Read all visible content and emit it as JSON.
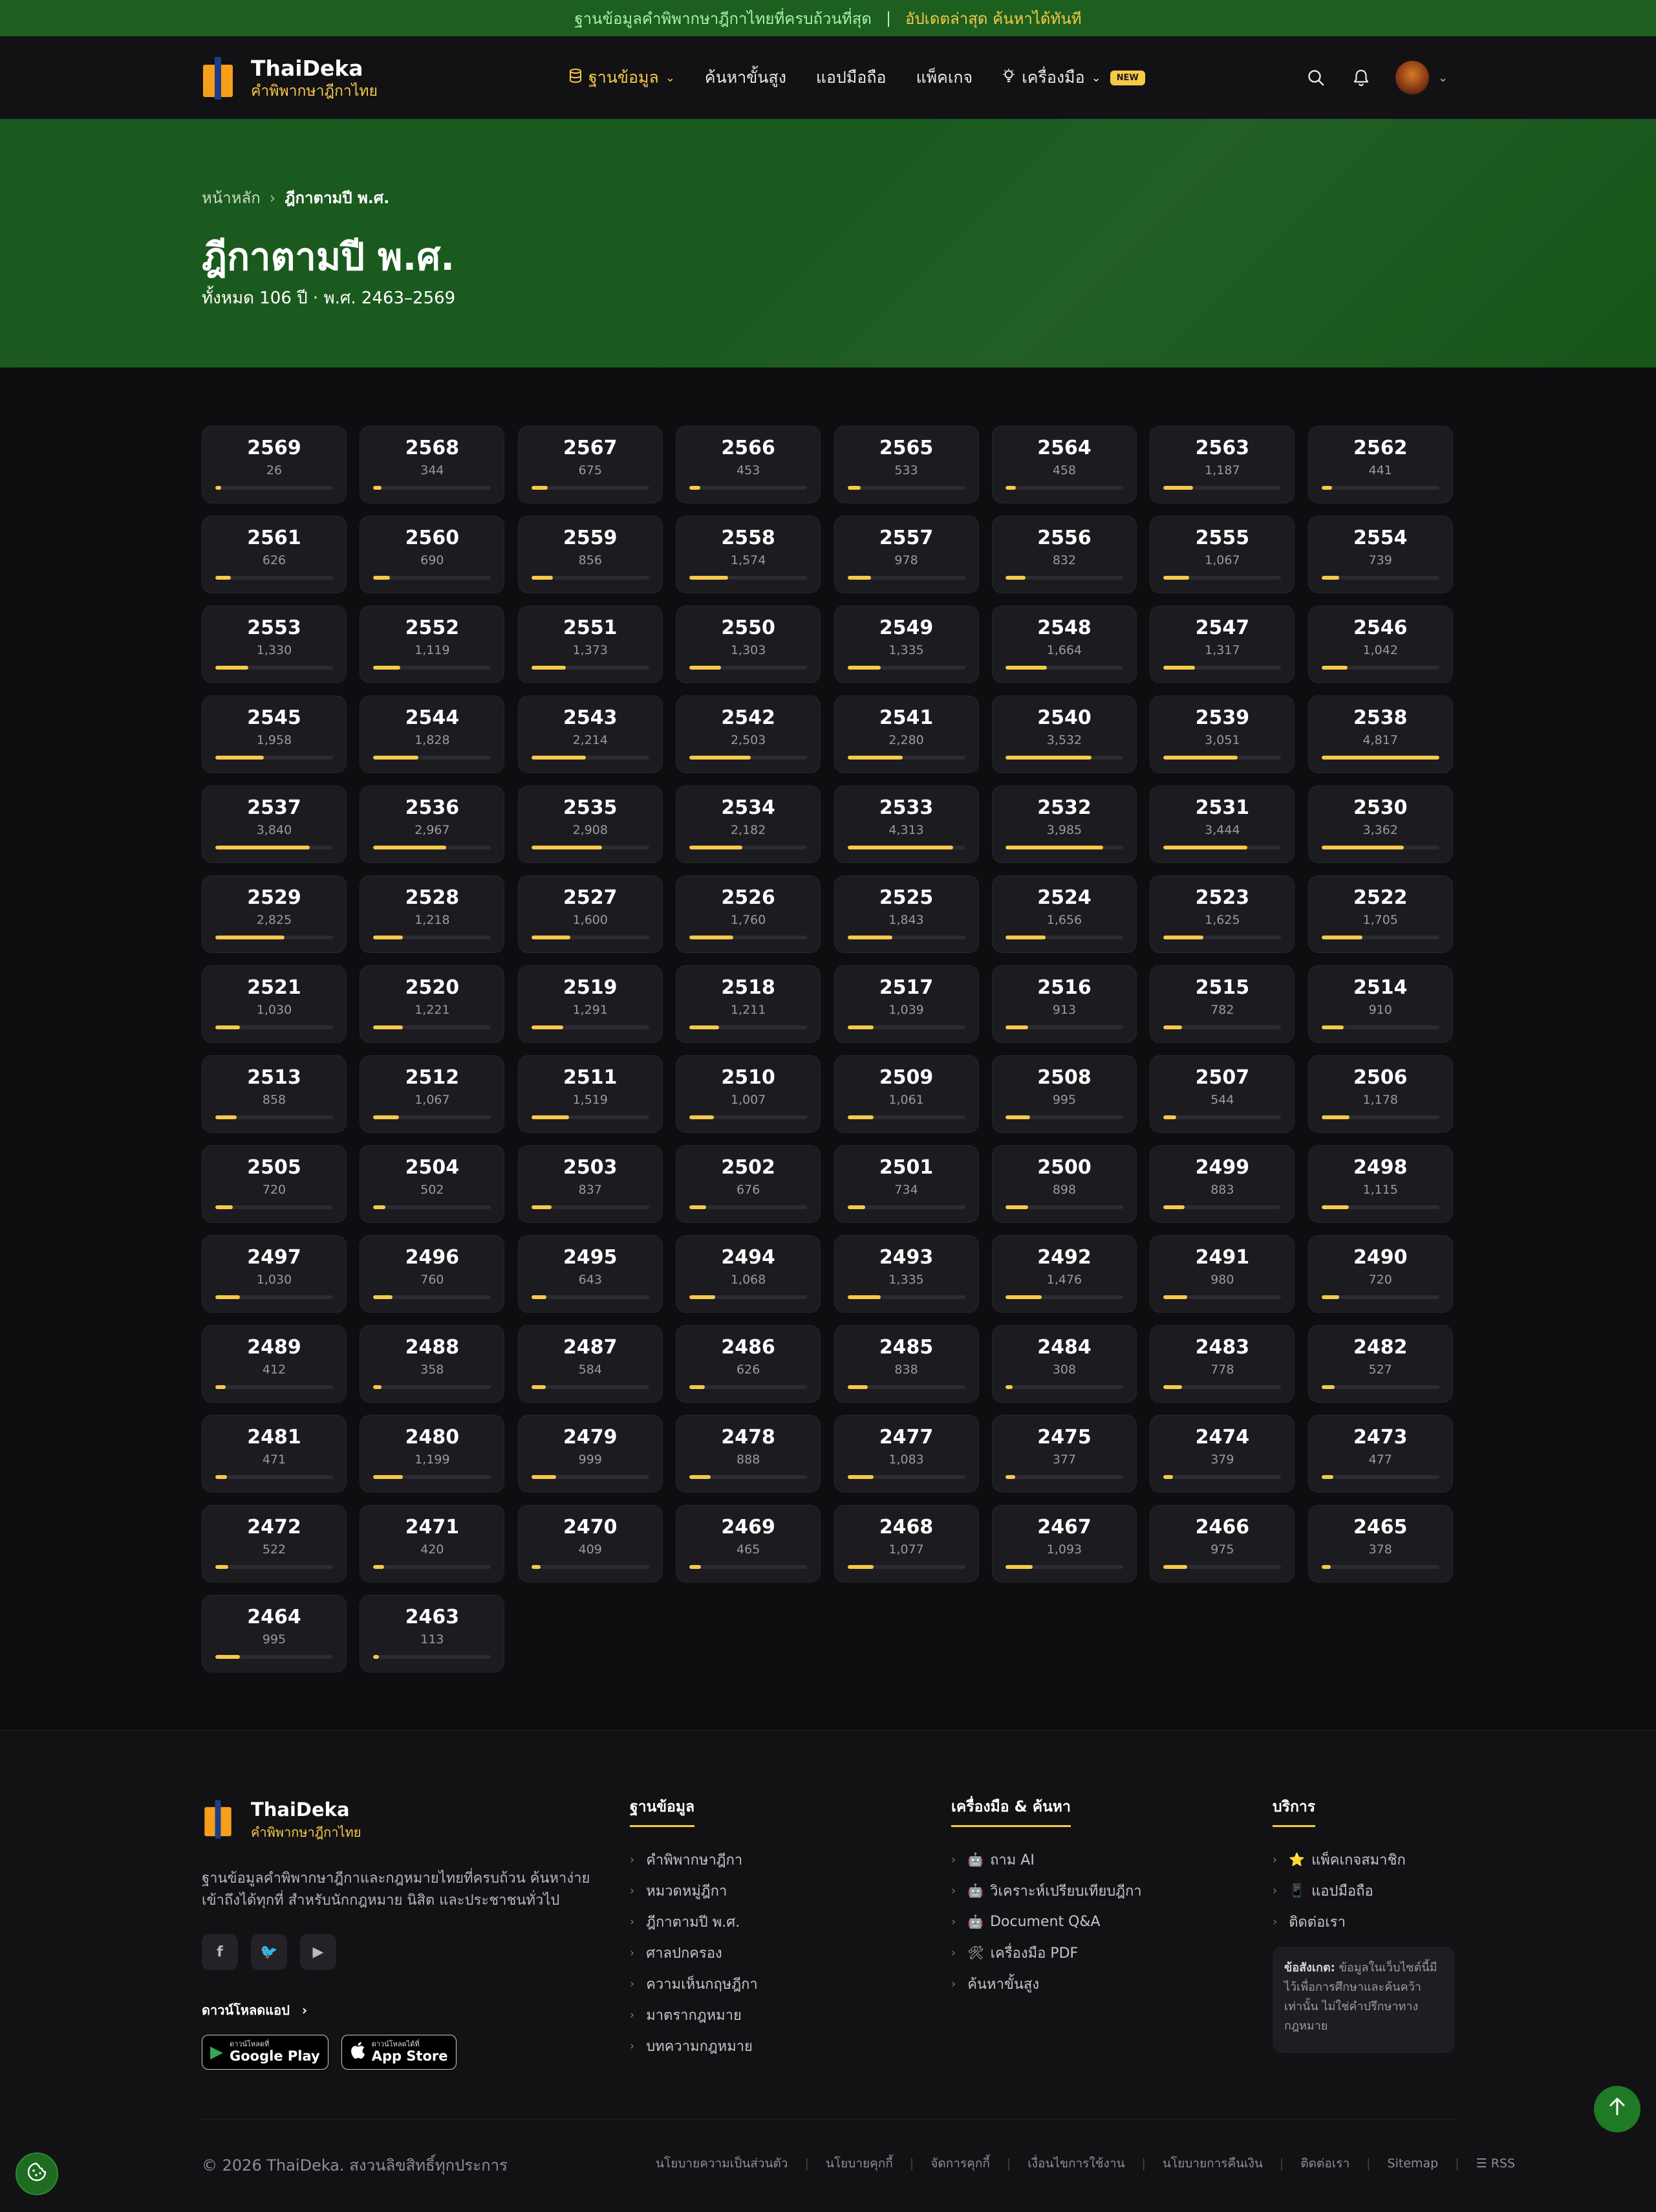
{
  "announcement": {
    "text": "ฐานข้อมูลคำพิพากษาฎีกาไทยที่ครบถ้วนที่สุด",
    "separator": "|",
    "highlight": "อัปเดตล่าสุด ค้นหาได้ทันที"
  },
  "brand": {
    "name": "ThaiDeka",
    "tagline": "คำพิพากษาฎีกาไทย"
  },
  "nav": {
    "items": [
      {
        "label": "ฐานข้อมูล",
        "icon": "database-icon",
        "has_dropdown": true,
        "active": true
      },
      {
        "label": "ค้นหาขั้นสูง"
      },
      {
        "label": "แอปมือถือ"
      },
      {
        "label": "แพ็คเกจ"
      },
      {
        "label": "เครื่องมือ",
        "icon": "lightbulb-icon",
        "has_dropdown": true,
        "badge": "NEW"
      }
    ]
  },
  "header_actions": {
    "search_icon": "search-icon",
    "bell_icon": "bell-icon",
    "avatar": "user-avatar"
  },
  "breadcrumb": {
    "home": "หน้าหลัก",
    "current": "ฎีกาตามปี พ.ศ."
  },
  "page": {
    "title": "ฎีกาตามปี พ.ศ.",
    "subtitle": "ทั้งหมด 106 ปี · พ.ศ. 2463–2569"
  },
  "years": [
    {
      "year": "2569",
      "count": "26",
      "level": 0.05
    },
    {
      "year": "2568",
      "count": "344",
      "level": 0.07
    },
    {
      "year": "2567",
      "count": "675",
      "level": 0.14
    },
    {
      "year": "2566",
      "count": "453",
      "level": 0.09
    },
    {
      "year": "2565",
      "count": "533",
      "level": 0.11
    },
    {
      "year": "2564",
      "count": "458",
      "level": 0.09
    },
    {
      "year": "2563",
      "count": "1,187",
      "level": 0.25
    },
    {
      "year": "2562",
      "count": "441",
      "level": 0.09
    },
    {
      "year": "2561",
      "count": "626",
      "level": 0.13
    },
    {
      "year": "2560",
      "count": "690",
      "level": 0.14
    },
    {
      "year": "2559",
      "count": "856",
      "level": 0.18
    },
    {
      "year": "2558",
      "count": "1,574",
      "level": 0.33
    },
    {
      "year": "2557",
      "count": "978",
      "level": 0.2
    },
    {
      "year": "2556",
      "count": "832",
      "level": 0.17
    },
    {
      "year": "2555",
      "count": "1,067",
      "level": 0.22
    },
    {
      "year": "2554",
      "count": "739",
      "level": 0.15
    },
    {
      "year": "2553",
      "count": "1,330",
      "level": 0.28
    },
    {
      "year": "2552",
      "count": "1,119",
      "level": 0.23
    },
    {
      "year": "2551",
      "count": "1,373",
      "level": 0.29
    },
    {
      "year": "2550",
      "count": "1,303",
      "level": 0.27
    },
    {
      "year": "2549",
      "count": "1,335",
      "level": 0.28
    },
    {
      "year": "2548",
      "count": "1,664",
      "level": 0.35
    },
    {
      "year": "2547",
      "count": "1,317",
      "level": 0.27
    },
    {
      "year": "2546",
      "count": "1,042",
      "level": 0.22
    },
    {
      "year": "2545",
      "count": "1,958",
      "level": 0.41
    },
    {
      "year": "2544",
      "count": "1,828",
      "level": 0.38
    },
    {
      "year": "2543",
      "count": "2,214",
      "level": 0.46
    },
    {
      "year": "2542",
      "count": "2,503",
      "level": 0.52
    },
    {
      "year": "2541",
      "count": "2,280",
      "level": 0.47
    },
    {
      "year": "2540",
      "count": "3,532",
      "level": 0.73
    },
    {
      "year": "2539",
      "count": "3,051",
      "level": 0.63
    },
    {
      "year": "2538",
      "count": "4,817",
      "level": 1.0
    },
    {
      "year": "2537",
      "count": "3,840",
      "level": 0.8
    },
    {
      "year": "2536",
      "count": "2,967",
      "level": 0.62
    },
    {
      "year": "2535",
      "count": "2,908",
      "level": 0.6
    },
    {
      "year": "2534",
      "count": "2,182",
      "level": 0.45
    },
    {
      "year": "2533",
      "count": "4,313",
      "level": 0.9
    },
    {
      "year": "2532",
      "count": "3,985",
      "level": 0.83
    },
    {
      "year": "2531",
      "count": "3,444",
      "level": 0.71
    },
    {
      "year": "2530",
      "count": "3,362",
      "level": 0.7
    },
    {
      "year": "2529",
      "count": "2,825",
      "level": 0.59
    },
    {
      "year": "2528",
      "count": "1,218",
      "level": 0.25
    },
    {
      "year": "2527",
      "count": "1,600",
      "level": 0.33
    },
    {
      "year": "2526",
      "count": "1,760",
      "level": 0.37
    },
    {
      "year": "2525",
      "count": "1,843",
      "level": 0.38
    },
    {
      "year": "2524",
      "count": "1,656",
      "level": 0.34
    },
    {
      "year": "2523",
      "count": "1,625",
      "level": 0.34
    },
    {
      "year": "2522",
      "count": "1,705",
      "level": 0.35
    },
    {
      "year": "2521",
      "count": "1,030",
      "level": 0.21
    },
    {
      "year": "2520",
      "count": "1,221",
      "level": 0.25
    },
    {
      "year": "2519",
      "count": "1,291",
      "level": 0.27
    },
    {
      "year": "2518",
      "count": "1,211",
      "level": 0.25
    },
    {
      "year": "2517",
      "count": "1,039",
      "level": 0.22
    },
    {
      "year": "2516",
      "count": "913",
      "level": 0.19
    },
    {
      "year": "2515",
      "count": "782",
      "level": 0.16
    },
    {
      "year": "2514",
      "count": "910",
      "level": 0.19
    },
    {
      "year": "2513",
      "count": "858",
      "level": 0.18
    },
    {
      "year": "2512",
      "count": "1,067",
      "level": 0.22
    },
    {
      "year": "2511",
      "count": "1,519",
      "level": 0.32
    },
    {
      "year": "2510",
      "count": "1,007",
      "level": 0.21
    },
    {
      "year": "2509",
      "count": "1,061",
      "level": 0.22
    },
    {
      "year": "2508",
      "count": "995",
      "level": 0.21
    },
    {
      "year": "2507",
      "count": "544",
      "level": 0.11
    },
    {
      "year": "2506",
      "count": "1,178",
      "level": 0.24
    },
    {
      "year": "2505",
      "count": "720",
      "level": 0.15
    },
    {
      "year": "2504",
      "count": "502",
      "level": 0.1
    },
    {
      "year": "2503",
      "count": "837",
      "level": 0.17
    },
    {
      "year": "2502",
      "count": "676",
      "level": 0.14
    },
    {
      "year": "2501",
      "count": "734",
      "level": 0.15
    },
    {
      "year": "2500",
      "count": "898",
      "level": 0.19
    },
    {
      "year": "2499",
      "count": "883",
      "level": 0.18
    },
    {
      "year": "2498",
      "count": "1,115",
      "level": 0.23
    },
    {
      "year": "2497",
      "count": "1,030",
      "level": 0.21
    },
    {
      "year": "2496",
      "count": "760",
      "level": 0.16
    },
    {
      "year": "2495",
      "count": "643",
      "level": 0.13
    },
    {
      "year": "2494",
      "count": "1,068",
      "level": 0.22
    },
    {
      "year": "2493",
      "count": "1,335",
      "level": 0.28
    },
    {
      "year": "2492",
      "count": "1,476",
      "level": 0.31
    },
    {
      "year": "2491",
      "count": "980",
      "level": 0.2
    },
    {
      "year": "2490",
      "count": "720",
      "level": 0.15
    },
    {
      "year": "2489",
      "count": "412",
      "level": 0.09
    },
    {
      "year": "2488",
      "count": "358",
      "level": 0.07
    },
    {
      "year": "2487",
      "count": "584",
      "level": 0.12
    },
    {
      "year": "2486",
      "count": "626",
      "level": 0.13
    },
    {
      "year": "2485",
      "count": "838",
      "level": 0.17
    },
    {
      "year": "2484",
      "count": "308",
      "level": 0.06
    },
    {
      "year": "2483",
      "count": "778",
      "level": 0.16
    },
    {
      "year": "2482",
      "count": "527",
      "level": 0.11
    },
    {
      "year": "2481",
      "count": "471",
      "level": 0.1
    },
    {
      "year": "2480",
      "count": "1,199",
      "level": 0.25
    },
    {
      "year": "2479",
      "count": "999",
      "level": 0.21
    },
    {
      "year": "2478",
      "count": "888",
      "level": 0.18
    },
    {
      "year": "2477",
      "count": "1,083",
      "level": 0.22
    },
    {
      "year": "2475",
      "count": "377",
      "level": 0.08
    },
    {
      "year": "2474",
      "count": "379",
      "level": 0.08
    },
    {
      "year": "2473",
      "count": "477",
      "level": 0.1
    },
    {
      "year": "2472",
      "count": "522",
      "level": 0.11
    },
    {
      "year": "2471",
      "count": "420",
      "level": 0.09
    },
    {
      "year": "2470",
      "count": "409",
      "level": 0.08
    },
    {
      "year": "2469",
      "count": "465",
      "level": 0.1
    },
    {
      "year": "2468",
      "count": "1,077",
      "level": 0.22
    },
    {
      "year": "2467",
      "count": "1,093",
      "level": 0.23
    },
    {
      "year": "2466",
      "count": "975",
      "level": 0.2
    },
    {
      "year": "2465",
      "count": "378",
      "level": 0.08
    },
    {
      "year": "2464",
      "count": "995",
      "level": 0.21
    },
    {
      "year": "2463",
      "count": "113",
      "level": 0.05
    }
  ],
  "footer": {
    "brand_name": "ThaiDeka",
    "brand_tagline": "คำพิพากษาฎีกาไทย",
    "description": "ฐานข้อมูลคำพิพากษาฎีกาและกฎหมายไทยที่ครบถ้วน ค้นหาง่าย เข้าถึงได้ทุกที่ สำหรับนักกฎหมาย นิสิต และประชาชนทั่วไป",
    "socials": [
      {
        "icon": "facebook-icon",
        "glyph": "f"
      },
      {
        "icon": "twitter-icon",
        "glyph": "🐦"
      },
      {
        "icon": "youtube-icon",
        "glyph": "▶"
      }
    ],
    "download_label": "ดาวน์โหลดแอป",
    "stores": [
      {
        "icon": "google-play-icon",
        "glyph": "▶",
        "small": "ดาวน์โหลดที่",
        "big": "Google Play"
      },
      {
        "icon": "apple-icon",
        "glyph": "",
        "small": "ดาวน์โหลดได้ที่",
        "big": "App Store"
      }
    ],
    "columns": [
      {
        "title": "ฐานข้อมูล",
        "items": [
          {
            "label": "คำพิพากษาฎีกา"
          },
          {
            "label": "หมวดหมู่ฎีกา"
          },
          {
            "label": "ฎีกาตามปี พ.ศ."
          },
          {
            "label": "ศาลปกครอง"
          },
          {
            "label": "ความเห็นกฤษฎีกา"
          },
          {
            "label": "มาตรากฎหมาย"
          },
          {
            "label": "บทความกฎหมาย"
          }
        ]
      },
      {
        "title": "เครื่องมือ & ค้นหา",
        "items": [
          {
            "label": "ถาม AI",
            "glyph": "🤖"
          },
          {
            "label": "วิเคราะห์เปรียบเทียบฎีกา",
            "glyph": "🤖"
          },
          {
            "label": "Document Q&A",
            "glyph": "🤖"
          },
          {
            "label": "เครื่องมือ PDF",
            "glyph": "🛠"
          },
          {
            "label": "ค้นหาขั้นสูง"
          }
        ]
      },
      {
        "title": "บริการ",
        "items": [
          {
            "label": "แพ็คเกจสมาชิก",
            "glyph": "⭐"
          },
          {
            "label": "แอปมือถือ",
            "glyph": "📱"
          },
          {
            "label": "ติดต่อเรา"
          }
        ]
      }
    ],
    "note_label": "ข้อสังเกต:",
    "note_text": "ข้อมูลในเว็บไซต์นี้มีไว้เพื่อการศึกษาและค้นคว้าเท่านั้น ไม่ใช่คำปรึกษาทางกฎหมาย",
    "copyright": "© 2026 ThaiDeka. สงวนลิขสิทธิ์ทุกประการ",
    "links": [
      {
        "label": "นโยบายความเป็นส่วนตัว"
      },
      {
        "label": "นโยบายคุกกี้"
      },
      {
        "label": "จัดการคุกกี้"
      },
      {
        "label": "เงื่อนไขการใช้งาน"
      },
      {
        "label": "นโยบายการคืนเงิน"
      },
      {
        "label": "ติดต่อเรา"
      },
      {
        "label": "Sitemap"
      },
      {
        "label": "RSS",
        "glyph": "☰"
      }
    ]
  },
  "floating": {
    "to_top_icon": "arrow-up-icon",
    "cookie_icon": "cookie-icon"
  },
  "colors": {
    "accent": "#f7c948",
    "brand_green": "#1d5f1f",
    "background": "#0e0e11",
    "card": "#1b1b20"
  }
}
